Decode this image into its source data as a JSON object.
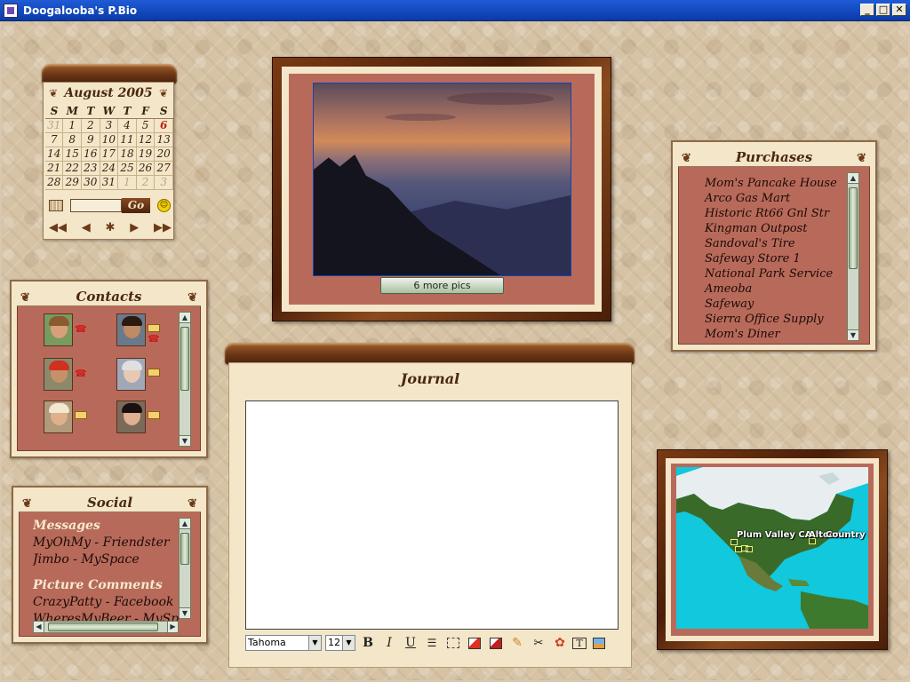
{
  "window": {
    "title": "Doogalooba's P.Bio",
    "buttons": {
      "minimize": "_",
      "maximize": "□",
      "close": "✕"
    }
  },
  "calendar": {
    "month_year": "August 2005",
    "weekdays": [
      "S",
      "M",
      "T",
      "W",
      "T",
      "F",
      "S"
    ],
    "weeks": [
      [
        "31",
        "1",
        "2",
        "3",
        "4",
        "5",
        "6"
      ],
      [
        "7",
        "8",
        "9",
        "10",
        "11",
        "12",
        "13"
      ],
      [
        "14",
        "15",
        "16",
        "17",
        "18",
        "19",
        "20"
      ],
      [
        "21",
        "22",
        "23",
        "24",
        "25",
        "26",
        "27"
      ],
      [
        "28",
        "29",
        "30",
        "31",
        "1",
        "2",
        "3"
      ]
    ],
    "today": "6",
    "go_label": "Go",
    "nav": {
      "first": "◀◀",
      "prev": "◀",
      "home": "✱",
      "next": "▶",
      "last": "▶▶"
    },
    "smiley": "☺"
  },
  "photo": {
    "more_pics_label": "6 more pics"
  },
  "purchases": {
    "title": "Purchases",
    "items": [
      "Mom's Pancake House",
      "Arco Gas Mart",
      "Historic Rt66 Gnl Str",
      "Kingman Outpost",
      "Sandoval's Tire",
      "Safeway Store 1",
      "National Park Service",
      "Ameoba",
      "Safeway",
      "Sierra Office Supply",
      "Mom's Diner"
    ]
  },
  "contacts": {
    "title": "Contacts",
    "people": [
      {
        "skin": "#d8a07a",
        "hair": "#8a5a30",
        "bg": "#7a9a60",
        "icons": [
          "phone"
        ]
      },
      {
        "skin": "#c08a64",
        "hair": "#2a1a10",
        "bg": "#6a7a8a",
        "icons": [
          "mail",
          "phone"
        ]
      },
      {
        "skin": "#c8906a",
        "hair": "#d03020",
        "bg": "#8a8a6a",
        "icons": [
          "phone"
        ]
      },
      {
        "skin": "#e8c8b0",
        "hair": "#e0e0e0",
        "bg": "#a0a8b8",
        "icons": [
          "mail"
        ]
      },
      {
        "skin": "#e0b08a",
        "hair": "#f0e8d0",
        "bg": "#b09a7a",
        "icons": [
          "mail"
        ]
      },
      {
        "skin": "#e0b090",
        "hair": "#1a1010",
        "bg": "#7a6a5a",
        "icons": [
          "mail"
        ]
      }
    ],
    "icon_glyphs": {
      "phone": "☎",
      "mail": ""
    }
  },
  "social": {
    "title": "Social",
    "sections": [
      {
        "header": "Messages",
        "items": [
          "MyOhMy - Friendster",
          "Jimbo - MySpace"
        ]
      },
      {
        "header": "Picture Comments",
        "items": [
          "CrazyPatty - Facebook",
          "WheresMyBeer - MySpace"
        ]
      }
    ]
  },
  "journal": {
    "title": "Journal",
    "font_name": "Tahoma",
    "font_size": "12",
    "tools": {
      "bold": "B",
      "italic": "I",
      "underline": "U"
    }
  },
  "map": {
    "labels": [
      "Plum Valley CA",
      "Altoona",
      "Country I"
    ]
  },
  "colors": {
    "wood": "#6b3515",
    "rose": "#b86a5a",
    "cream": "#f3e6c9",
    "ocean": "#12c8dc"
  }
}
